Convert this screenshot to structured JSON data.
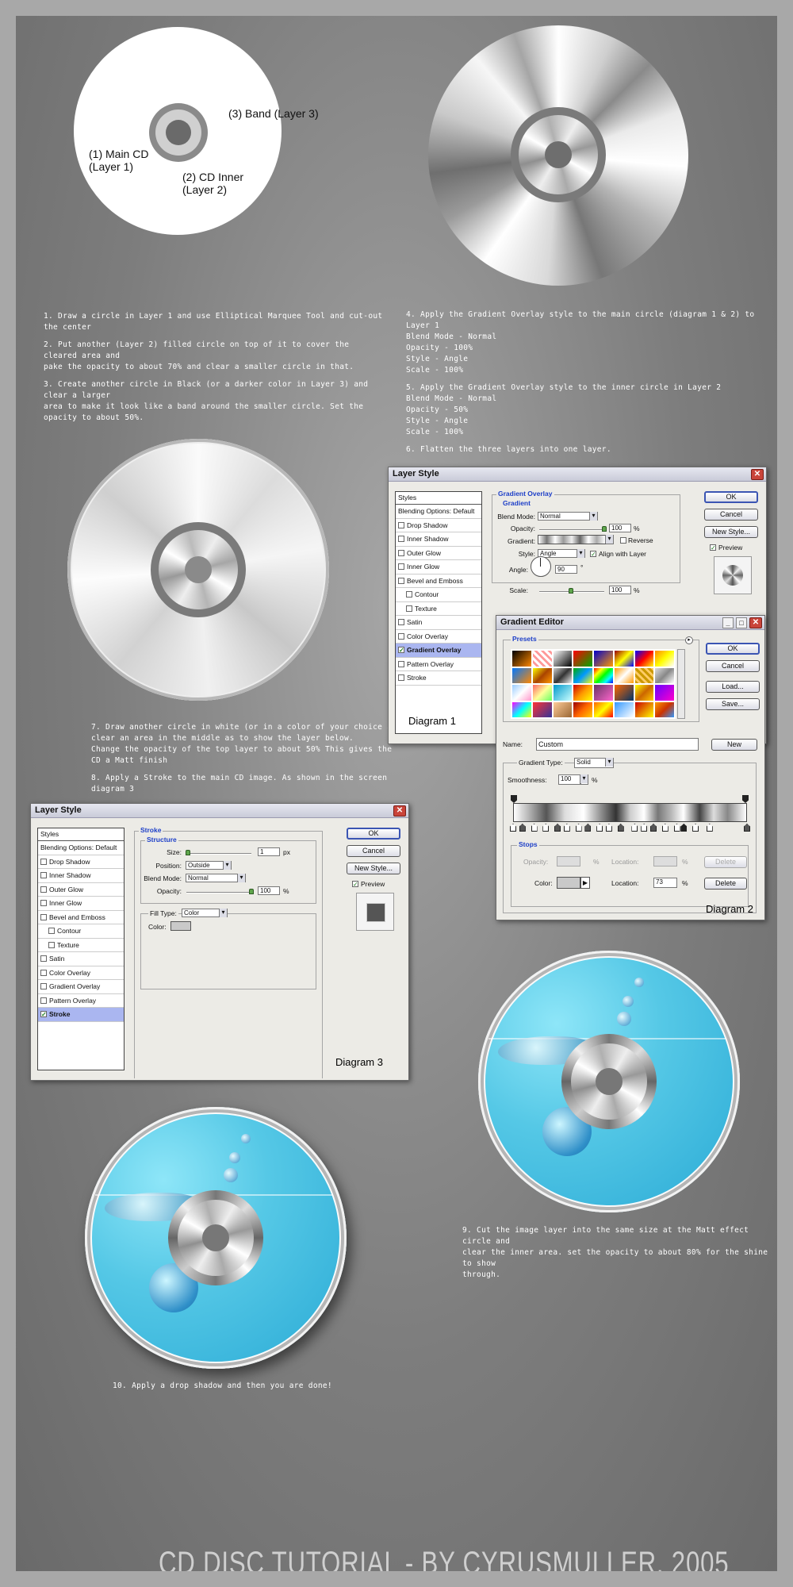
{
  "diagram0_labels": {
    "band": "(3) Band (Layer 3)",
    "main": "(1) Main CD\n(Layer 1)",
    "inner": "(2) CD Inner\n(Layer 2)"
  },
  "steps": {
    "s1": "1. Draw a circle in Layer 1 and use Elliptical Marquee Tool and cut-out the center",
    "s2": "2. Put another (Layer 2) filled circle on top of it to cover the cleared area and\npake the opacity to about 70% and clear a smaller circle in that.",
    "s3": "3. Create another circle in Black (or a darker color in Layer 3) and clear a larger\narea to make it look like a band around the smaller circle. Set the\nopacity to about 50%.",
    "s4": "4. Apply the Gradient Overlay style to the main circle (diagram 1 & 2) to Layer 1\nBlend Mode - Normal\nOpacity - 100%\nStyle - Angle\nScale - 100%",
    "s5": "5. Apply the Gradient Overlay style to the inner circle in Layer 2\nBlend Mode - Normal\nOpacity - 50%\nStyle - Angle\nScale - 100%",
    "s6": "6. Flatten the three layers into one layer.",
    "s7": "7.  Draw another circle in white (or in a color of your choice and\nclear an area in the middle as to show the layer below.\nChange the opacity of the top layer to about 50% This gives the\nCD a Matt finish",
    "s8": "8. Apply a Stroke to the main CD image. As shown in the screen diagram 3",
    "s9": "9. Cut the image layer into the same size at the Matt effect circle and\nclear the inner area. set the opacity to about 80% for the shine to show\nthrough.",
    "s10": "10. Apply a drop shadow and then you are done!"
  },
  "layer_style_1": {
    "title": "Layer Style",
    "styles_header": "Styles",
    "items": [
      "Blending Options: Default",
      "Drop Shadow",
      "Inner Shadow",
      "Outer Glow",
      "Inner Glow",
      "Bevel and Emboss",
      "Contour",
      "Texture",
      "Satin",
      "Color Overlay",
      "Gradient Overlay",
      "Pattern Overlay",
      "Stroke"
    ],
    "group_title": "Gradient Overlay",
    "sub_title": "Gradient",
    "blend_mode_label": "Blend Mode:",
    "blend_mode_value": "Normal",
    "opacity_label": "Opacity:",
    "opacity_value": "100",
    "opacity_unit": "%",
    "gradient_label": "Gradient:",
    "reverse_label": "Reverse",
    "style_label": "Style:",
    "style_value": "Angle",
    "align_label": "Align with Layer",
    "angle_label": "Angle:",
    "angle_value": "90",
    "angle_unit": "°",
    "scale_label": "Scale:",
    "scale_value": "100",
    "scale_unit": "%",
    "ok": "OK",
    "cancel": "Cancel",
    "new_style": "New Style...",
    "preview": "Preview",
    "diagram_label": "Diagram 1"
  },
  "gradient_editor": {
    "title": "Gradient Editor",
    "presets_label": "Presets",
    "ok": "OK",
    "cancel": "Cancel",
    "load": "Load...",
    "save": "Save...",
    "name_label": "Name:",
    "name_value": "Custom",
    "new": "New",
    "gradient_type_label": "Gradient Type:",
    "gradient_type_value": "Solid",
    "smoothness_label": "Smoothness:",
    "smoothness_value": "100",
    "smoothness_unit": "%",
    "stops_label": "Stops",
    "opacity_label": "Opacity:",
    "location_label": "Location:",
    "delete": "Delete",
    "color_label": "Color:",
    "location_value": "73",
    "unit": "%",
    "diagram_label": "Diagram 2"
  },
  "layer_style_3": {
    "title": "Layer Style",
    "styles_header": "Styles",
    "items": [
      "Blending Options: Default",
      "Drop Shadow",
      "Inner Shadow",
      "Outer Glow",
      "Inner Glow",
      "Bevel and Emboss",
      "Contour",
      "Texture",
      "Satin",
      "Color Overlay",
      "Gradient Overlay",
      "Pattern Overlay",
      "Stroke"
    ],
    "group_title": "Stroke",
    "sub_title": "Structure",
    "size_label": "Size:",
    "size_value": "1",
    "size_unit": "px",
    "position_label": "Position:",
    "position_value": "Outside",
    "blend_mode_label": "Blend Mode:",
    "blend_mode_value": "Normal",
    "opacity_label": "Opacity:",
    "opacity_value": "100",
    "opacity_unit": "%",
    "fill_type_label": "Fill Type:",
    "fill_type_value": "Color",
    "color_label": "Color:",
    "ok": "OK",
    "cancel": "Cancel",
    "new_style": "New Style...",
    "preview": "Preview",
    "diagram_label": "Diagram 3"
  },
  "footer": "CD DISC TUTORIAL - BY CYRUSMULLER. 2005",
  "colors": {
    "background": "#7d7d7d",
    "frame": "#a8a8a8",
    "accent_blue": "#1d3fc8",
    "water": "#55c8e6"
  }
}
